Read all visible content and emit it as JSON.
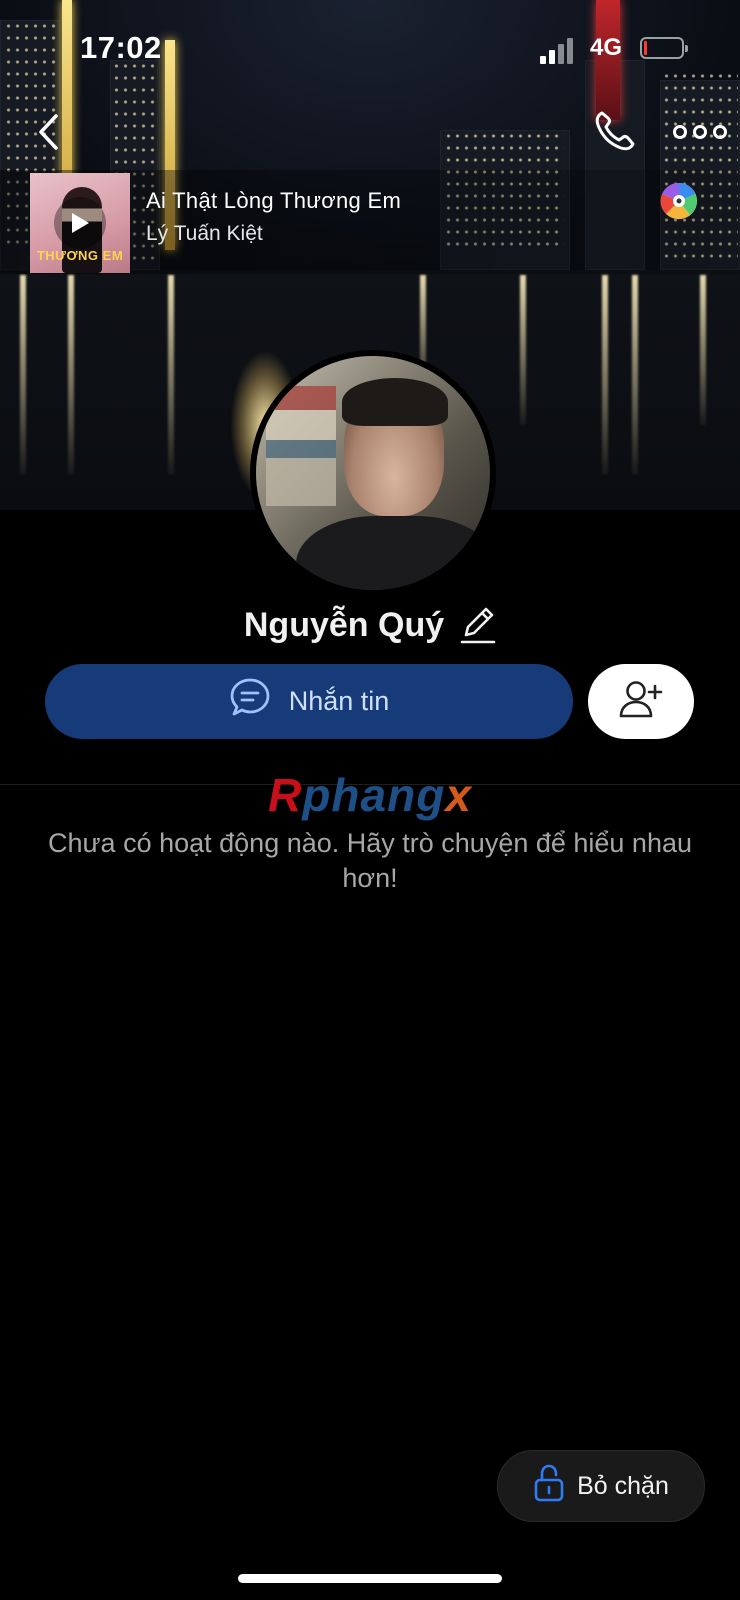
{
  "status_bar": {
    "time": "17:02",
    "network": "4G",
    "battery_level": 0.05,
    "battery_color": "#ff3b30"
  },
  "nav": {
    "back_icon": "chevron-left-icon",
    "call_icon": "phone-icon",
    "more_icon": "more-dots-icon"
  },
  "music": {
    "title": "Ai Thật Lòng Thương Em",
    "artist": "Lý Tuấn Kiệt",
    "album_text": "THƯƠNG EM",
    "play_icon": "play-icon",
    "disc_icon": "music-disc-icon"
  },
  "profile": {
    "name": "Nguyễn Quý",
    "edit_icon": "pencil-icon"
  },
  "actions": {
    "message_label": "Nhắn tin",
    "message_icon": "chat-bubble-icon",
    "add_friend_icon": "add-friend-icon",
    "message_color": "#173a78"
  },
  "watermark": {
    "part1": "R",
    "part2": "phang",
    "part3": "x"
  },
  "feed": {
    "empty_text": "Chưa có hoạt động nào. Hãy trò chuyện để hiểu nhau hơn!"
  },
  "unblock": {
    "label": "Bỏ chặn",
    "icon": "unlock-icon",
    "accent": "#2f7bf6"
  }
}
